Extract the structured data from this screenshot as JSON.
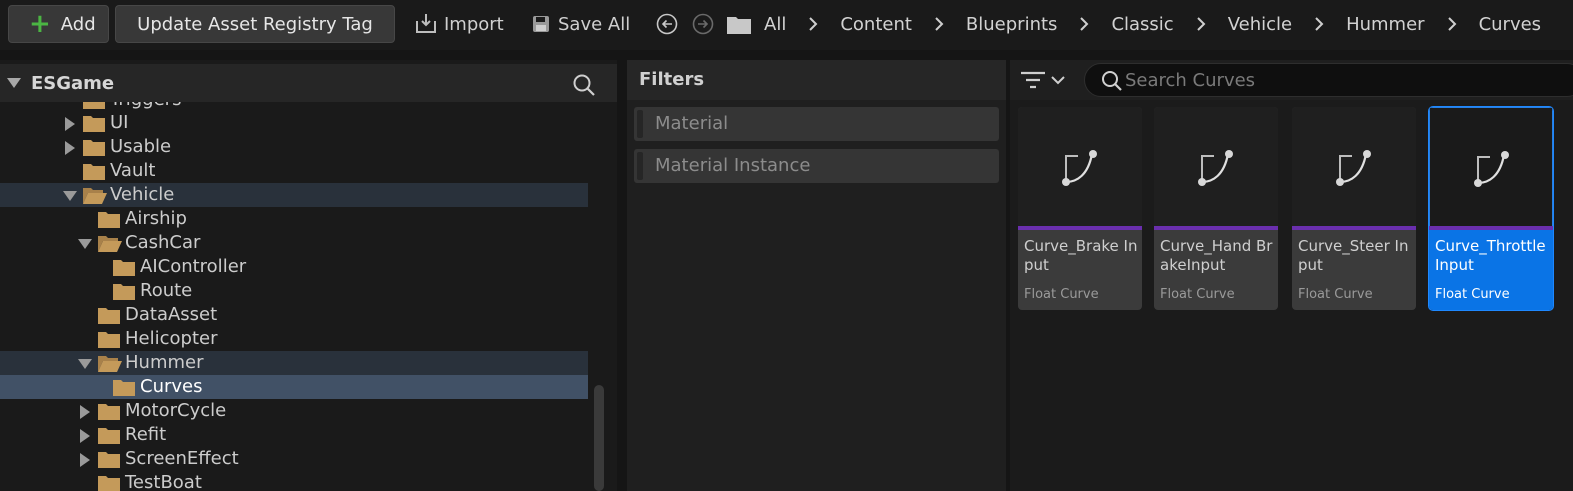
{
  "toolbar": {
    "add_label": "Add",
    "update_tag_label": "Update Asset Registry Tag",
    "import_label": "Import",
    "save_all_label": "Save All"
  },
  "breadcrumb": [
    "All",
    "Content",
    "Blueprints",
    "Classic",
    "Vehicle",
    "Hummer",
    "Curves"
  ],
  "tree": {
    "root_label": "ESGame",
    "items": [
      {
        "label": "Triggers",
        "state": "leaf"
      },
      {
        "label": "UI",
        "state": "collapsed"
      },
      {
        "label": "Usable",
        "state": "collapsed"
      },
      {
        "label": "Vault",
        "state": "leaf"
      },
      {
        "label": "Vehicle",
        "state": "expanded"
      },
      {
        "label": "Airship",
        "state": "leaf"
      },
      {
        "label": "CashCar",
        "state": "expanded"
      },
      {
        "label": "AIController",
        "state": "leaf"
      },
      {
        "label": "Route",
        "state": "leaf"
      },
      {
        "label": "DataAsset",
        "state": "leaf"
      },
      {
        "label": "Helicopter",
        "state": "leaf"
      },
      {
        "label": "Hummer",
        "state": "expanded"
      },
      {
        "label": "Curves",
        "state": "selected"
      },
      {
        "label": "MotorCycle",
        "state": "collapsed"
      },
      {
        "label": "Refit",
        "state": "collapsed"
      },
      {
        "label": "ScreenEffect",
        "state": "collapsed"
      },
      {
        "label": "TestBoat",
        "state": "leaf"
      }
    ]
  },
  "filters": {
    "title": "Filters",
    "items": [
      "Material",
      "Material Instance"
    ]
  },
  "content": {
    "search_placeholder": "Search Curves",
    "assets": [
      {
        "name": "Curve_Brake Input",
        "type": "Float Curve",
        "selected": false
      },
      {
        "name": "Curve_Hand BrakeInput",
        "type": "Float Curve",
        "selected": false
      },
      {
        "name": "Curve_Steer Input",
        "type": "Float Curve",
        "selected": false
      },
      {
        "name": "Curve_Throttle Input",
        "type": "Float Curve",
        "selected": true
      }
    ]
  },
  "colors": {
    "accent_blue": "#0a74e6",
    "curve_band": "#6a2fae",
    "folder": "#c49a5a",
    "add_plus": "#4bb543"
  }
}
